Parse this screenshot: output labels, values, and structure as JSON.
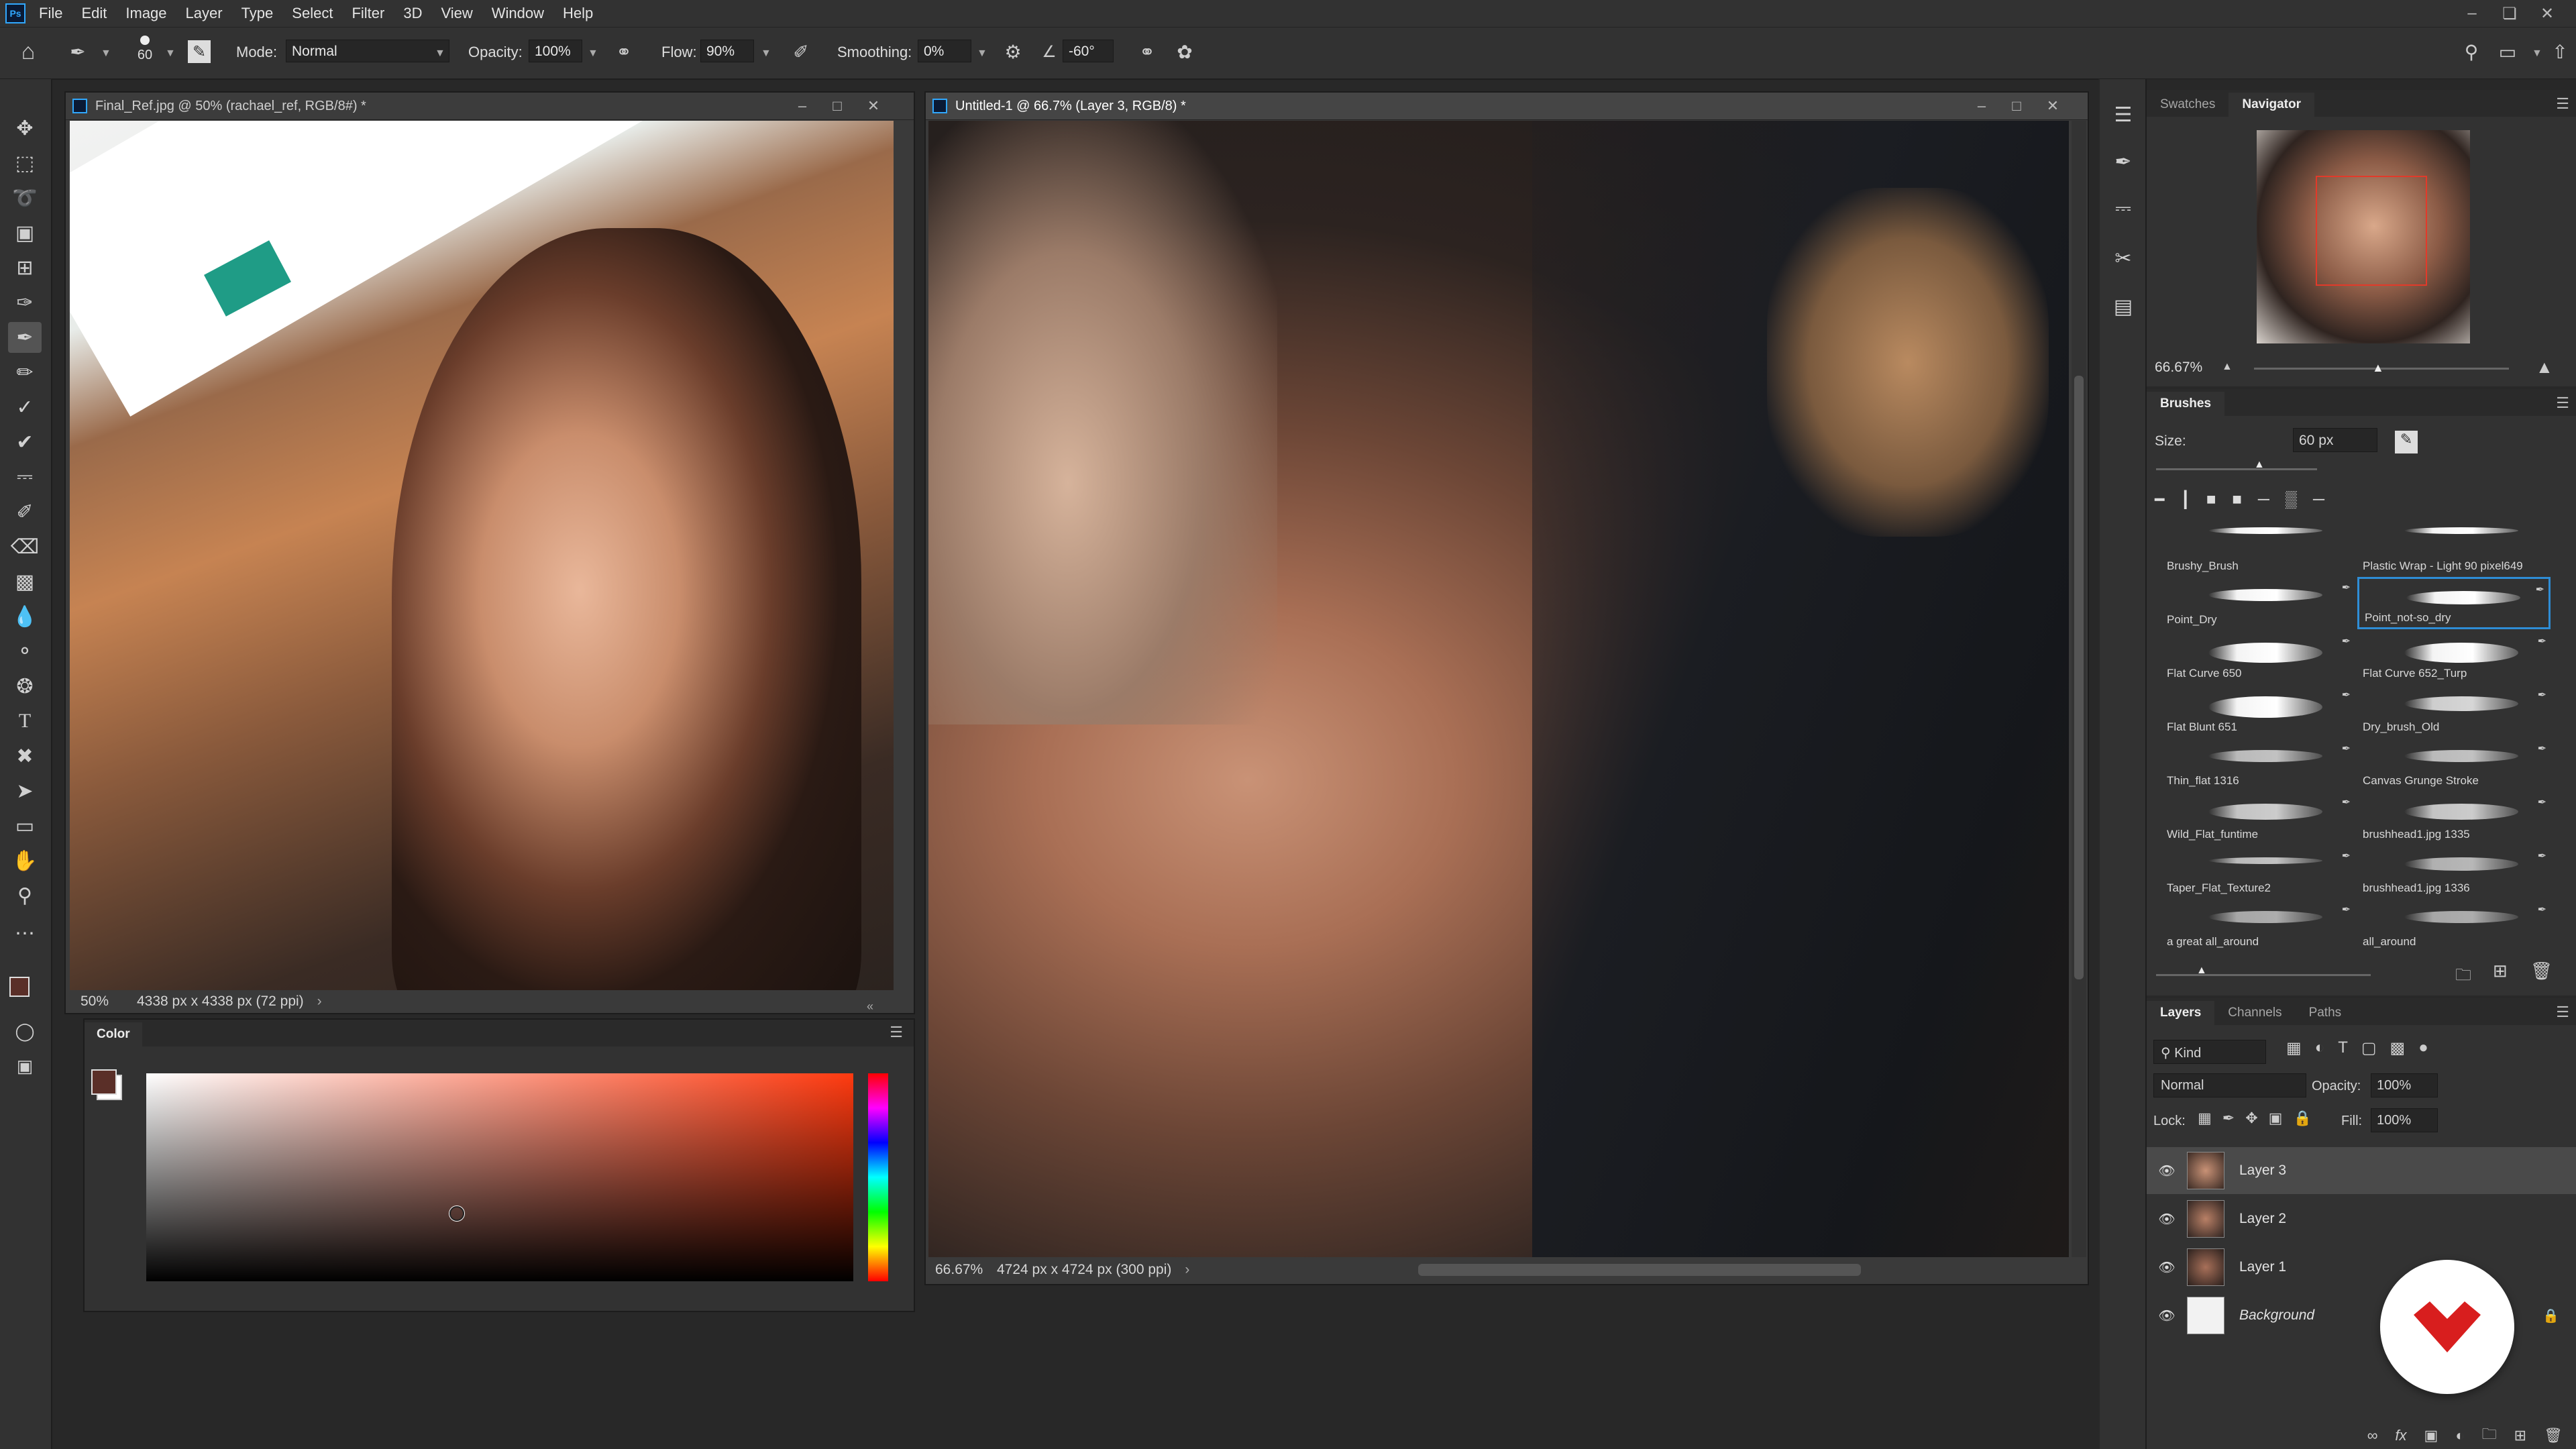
{
  "menubar": {
    "items": [
      "File",
      "Edit",
      "Image",
      "Layer",
      "Type",
      "Select",
      "Filter",
      "3D",
      "View",
      "Window",
      "Help"
    ],
    "logo": "Ps"
  },
  "options": {
    "brush_size": "60",
    "mode_label": "Mode:",
    "mode_value": "Normal",
    "opacity_label": "Opacity:",
    "opacity_value": "100%",
    "flow_label": "Flow:",
    "flow_value": "90%",
    "smoothing_label": "Smoothing:",
    "smoothing_value": "0%",
    "angle_value": "-60°"
  },
  "doc_ref": {
    "title": "Final_Ref.jpg @ 50% (rachael_ref, RGB/8#) *",
    "zoom": "50%",
    "info": "4338 px x 4338 px (72 ppi)"
  },
  "doc_main": {
    "title": "Untitled-1 @ 66.7% (Layer 3, RGB/8) *",
    "zoom": "66.67%",
    "info": "4724 px x 4724 px (300 ppi)"
  },
  "color_panel": {
    "tab": "Color",
    "fg_color": "#5a2f28",
    "bg_color": "#ffffff",
    "hue_color": "#ff3a10"
  },
  "navigator": {
    "tabs": [
      "Swatches",
      "Navigator"
    ],
    "active_tab": "Navigator",
    "zoom": "66.67%"
  },
  "brushes": {
    "tab": "Brushes",
    "size_label": "Size:",
    "size_value": "60 px",
    "items": [
      {
        "name": "Brushy_Brush"
      },
      {
        "name": "Plastic Wrap - Light 90 pixel649"
      },
      {
        "name": "Point_Dry"
      },
      {
        "name": "Point_not-so_dry"
      },
      {
        "name": "Flat Curve 650"
      },
      {
        "name": "Flat Curve 652_Turp"
      },
      {
        "name": "Flat Blunt 651"
      },
      {
        "name": "Dry_brush_Old"
      },
      {
        "name": "Thin_flat 1316"
      },
      {
        "name": "Canvas Grunge Stroke"
      },
      {
        "name": "Wild_Flat_funtime"
      },
      {
        "name": "brushhead1.jpg 1335"
      },
      {
        "name": "Taper_Flat_Texture2"
      },
      {
        "name": "brushhead1.jpg 1336"
      },
      {
        "name": "a great all_around"
      },
      {
        "name": "all_around"
      }
    ],
    "selected": "Point_not-so_dry"
  },
  "layers_panel": {
    "tabs": [
      "Layers",
      "Channels",
      "Paths"
    ],
    "active_tab": "Layers",
    "kind_label": "Kind",
    "blend_mode": "Normal",
    "opacity_label": "Opacity:",
    "opacity_value": "100%",
    "lock_label": "Lock:",
    "fill_label": "Fill:",
    "fill_value": "100%",
    "layers": [
      {
        "name": "Layer 3",
        "selected": true
      },
      {
        "name": "Layer 2",
        "selected": false
      },
      {
        "name": "Layer 1",
        "selected": false
      },
      {
        "name": "Background",
        "selected": false,
        "locked": true
      }
    ]
  },
  "accent_color": "#2e8dd6",
  "badge_color": "#d81e1e"
}
